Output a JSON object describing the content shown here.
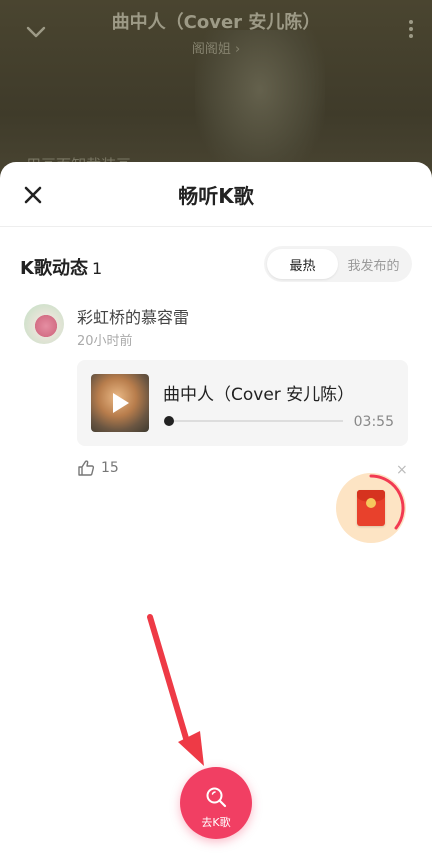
{
  "player": {
    "song_title": "曲中人（Cover 安儿陈）",
    "artist": "阁阁姐 ›",
    "lyric_fragment": "用画面卸载装画"
  },
  "sheet": {
    "title": "畅听K歌",
    "section_title": "K歌动态",
    "section_count": "1",
    "tabs": [
      {
        "label": "最热",
        "active": true
      },
      {
        "label": "我发布的",
        "active": false
      }
    ]
  },
  "post": {
    "username": "彩虹桥的慕容雷",
    "time": "20小时前",
    "song": {
      "name": "曲中人（Cover 安儿陈）",
      "duration": "03:55",
      "progress": 0.0
    },
    "likes": "15"
  },
  "floating": {
    "close_label": "×",
    "icon": "red-envelope-icon"
  },
  "go_button": {
    "label": "去K歌",
    "icon": "search-icon"
  },
  "colors": {
    "accent": "#f13f63",
    "annotation_arrow": "#ee3a46"
  }
}
